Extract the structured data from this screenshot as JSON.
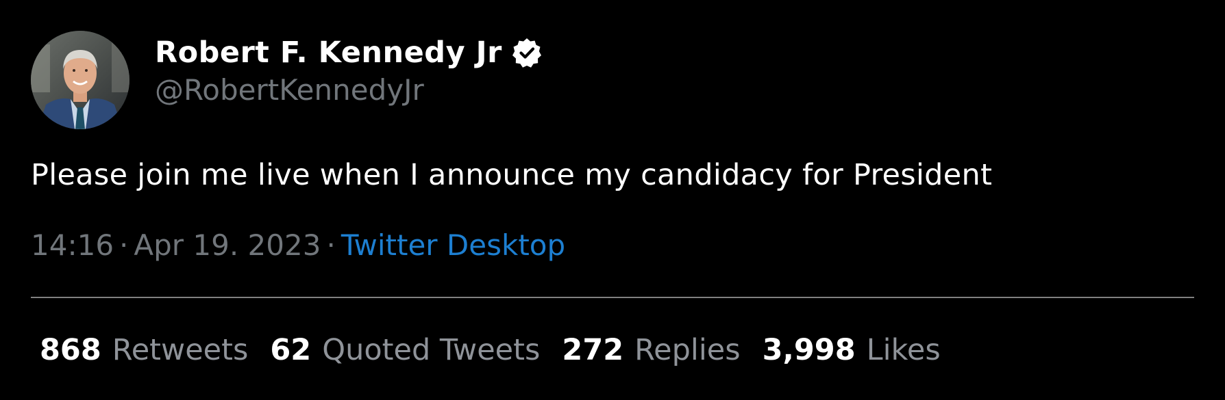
{
  "tweet": {
    "author": {
      "display_name": "Robert F. Kennedy Jr",
      "handle": "@RobertKennedyJr",
      "verified_icon": "verified-badge-icon",
      "avatar": "profile-photo"
    },
    "text": "Please join me live when I announce my candidacy for President",
    "meta": {
      "time": "14:16",
      "separator": "·",
      "date": "Apr 19. 2023",
      "source": "Twitter Desktop"
    },
    "stats": [
      {
        "count": "868",
        "label": "Retweets"
      },
      {
        "count": "62",
        "label": "Quoted Tweets"
      },
      {
        "count": "272",
        "label": "Replies"
      },
      {
        "count": "3,998",
        "label": "Likes"
      }
    ]
  },
  "colors": {
    "background": "#000000",
    "text_primary": "#ffffff",
    "text_secondary": "#71767b",
    "link": "#1d7fd1",
    "divider": "#808080"
  }
}
